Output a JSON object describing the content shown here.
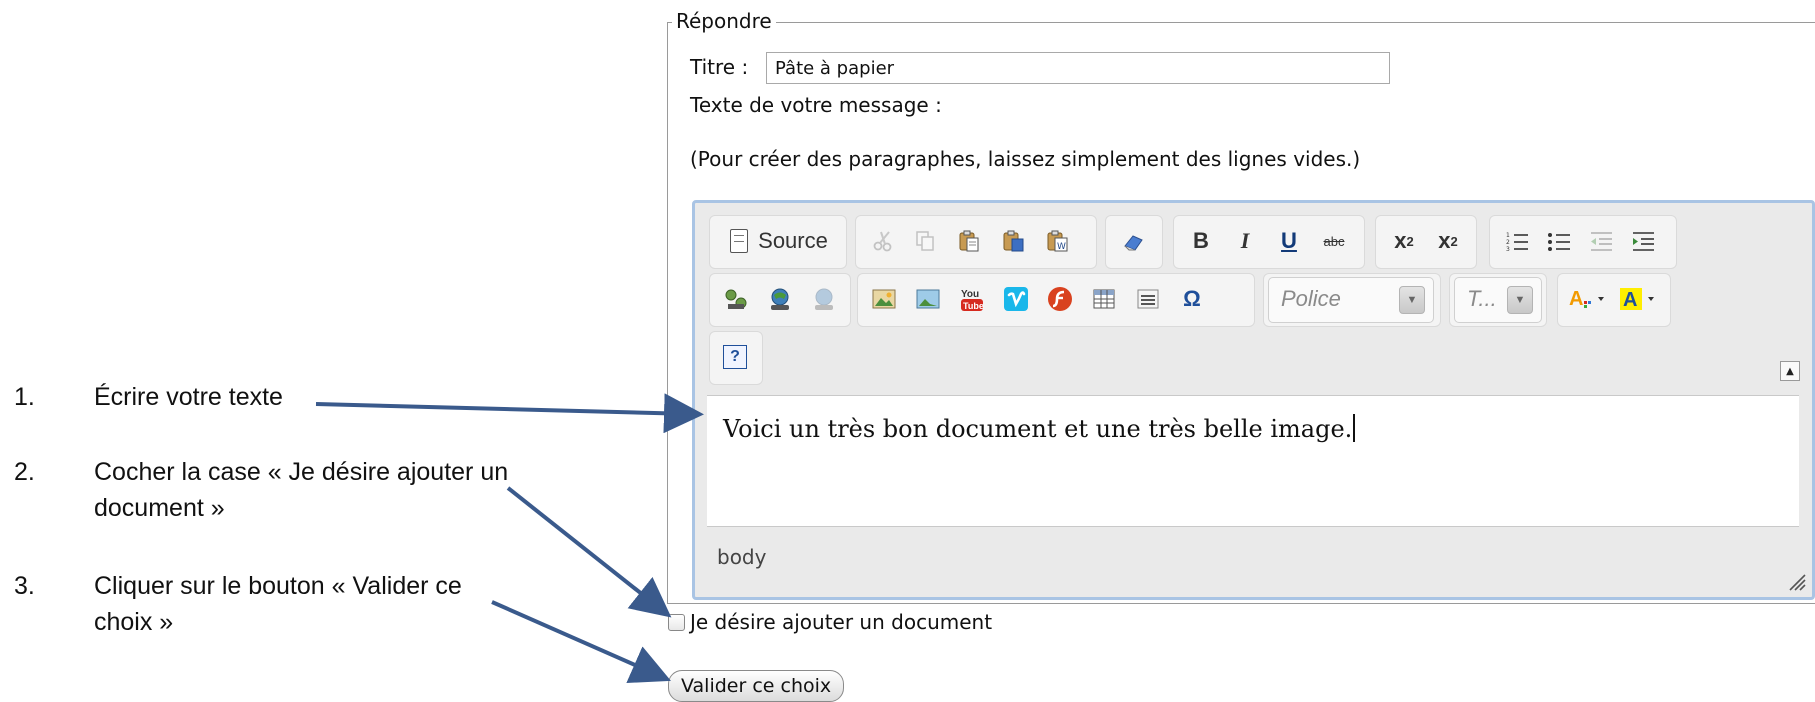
{
  "instructions": {
    "steps": [
      {
        "number": "1.",
        "line1": "Écrire votre texte",
        "line2": ""
      },
      {
        "number": "2.",
        "line1": "Cocher la case « Je désire ajouter un",
        "line2": "document »"
      },
      {
        "number": "3.",
        "line1": "Cliquer sur le bouton « Valider ce",
        "line2": "choix »"
      }
    ]
  },
  "form": {
    "legend": "Répondre",
    "title_label": "Titre :",
    "title_value": "Pâte à papier",
    "message_label": "Texte de votre message :",
    "hint": "(Pour créer des paragraphes, laissez simplement des lignes vides.)",
    "checkbox_label": "Je désire ajouter un document",
    "submit_label": "Valider ce choix"
  },
  "editor": {
    "source_label": "Source",
    "bold": "B",
    "italic": "I",
    "underline": "U",
    "strike": "abc",
    "font_combo": "Police",
    "size_combo": "T...",
    "help_glyph": "?",
    "content": "Voici un très bon document et une très belle image.",
    "path": "body",
    "icons": [
      "cut-icon",
      "copy-icon",
      "paste-icon",
      "paste-text-icon",
      "paste-word-icon",
      "eraser-icon",
      "subscript-icon",
      "superscript-icon",
      "numbered-list-icon",
      "bulleted-list-icon",
      "outdent-icon",
      "indent-icon",
      "link-icon",
      "anchor-icon",
      "unlink-icon",
      "image-icon",
      "media-icon",
      "youtube-icon",
      "vimeo-icon",
      "flash-icon",
      "table-icon",
      "horizontal-rule-icon",
      "omega-icon",
      "text-color-icon",
      "background-color-icon",
      "help-icon",
      "collapse-toolbar-icon",
      "resize-handle-icon"
    ]
  },
  "colors": {
    "arrow": "#3a5a8c",
    "editor_border": "#a9c4e4",
    "toolbar_bg": "#eaeaea"
  }
}
